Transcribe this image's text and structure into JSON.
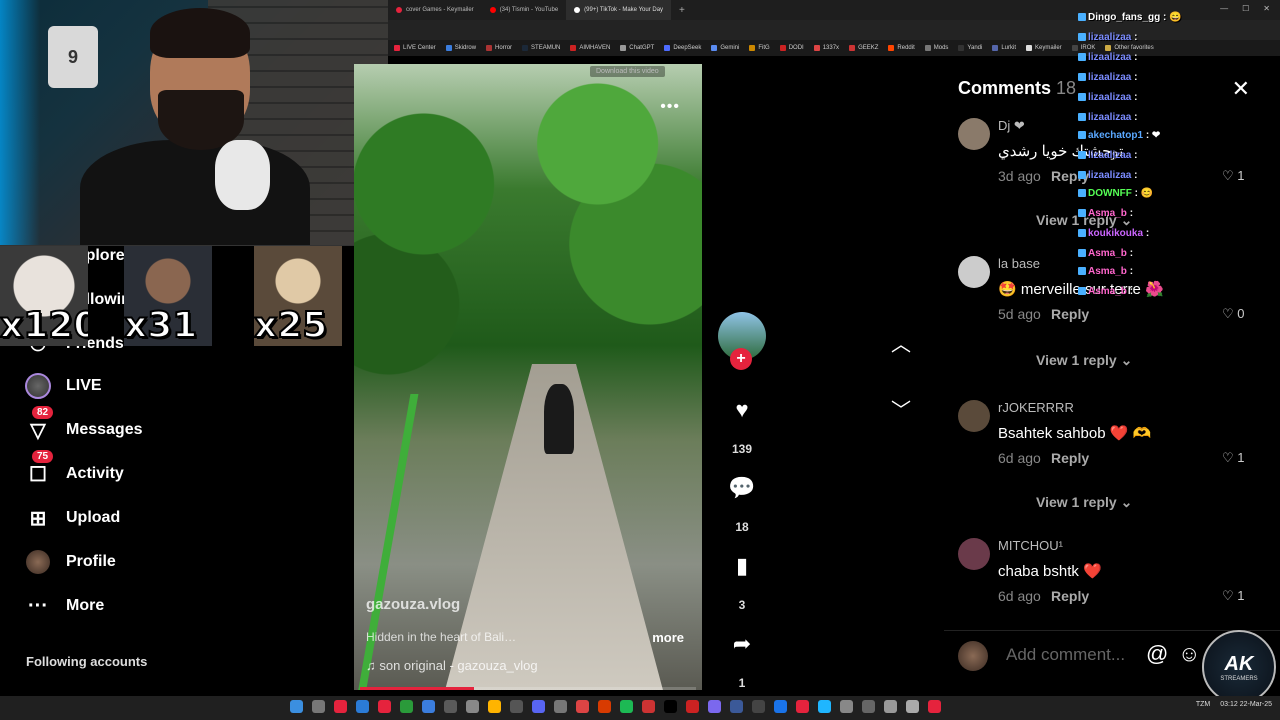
{
  "browser": {
    "tabs": [
      {
        "label": "cover Games - Keymailer",
        "color": "#e5233d"
      },
      {
        "label": "(34) Tismin - YouTube",
        "color": "#ff0000"
      },
      {
        "label": "(99+) TikTok - Make Your Day",
        "color": "#ffffff"
      }
    ],
    "new_tab": "+",
    "bookmarks": [
      {
        "label": "LIVE Center",
        "color": "#e5233d"
      },
      {
        "label": "Skidrow",
        "color": "#3b7ddd"
      },
      {
        "label": "Horror",
        "color": "#aa3333"
      },
      {
        "label": "STEAMUN",
        "color": "#1b2838"
      },
      {
        "label": "AIMHAVEN",
        "color": "#cc2222"
      },
      {
        "label": "ChatGPT",
        "color": "#999999"
      },
      {
        "label": "DeepSeek",
        "color": "#4d6bfe"
      },
      {
        "label": "Gemini",
        "color": "#5a8bf0"
      },
      {
        "label": "FitG",
        "color": "#cc8800"
      },
      {
        "label": "DODI",
        "color": "#cc2222"
      },
      {
        "label": "1337x",
        "color": "#dd4444"
      },
      {
        "label": "GEEKZ",
        "color": "#cc3333"
      },
      {
        "label": "Reddit",
        "color": "#ff4500"
      },
      {
        "label": "Mods",
        "color": "#777777"
      },
      {
        "label": "Yandi",
        "color": "#333333"
      },
      {
        "label": "Lurkit",
        "color": "#5566aa"
      },
      {
        "label": "Keymailer",
        "color": "#dddddd"
      },
      {
        "label": "IROK",
        "color": "#444444"
      },
      {
        "label": "Other favorites",
        "color": "#ccaa44"
      }
    ],
    "download_badge": "Download this video"
  },
  "nav": {
    "items": [
      {
        "label": "Explore",
        "icon": "compass-icon",
        "glyph": "⊘"
      },
      {
        "label": "Following",
        "icon": "following-icon",
        "glyph": "⚇"
      },
      {
        "label": "Friends",
        "icon": "friends-icon",
        "glyph": "⚇"
      },
      {
        "label": "LIVE",
        "icon": "live-icon",
        "glyph": ""
      },
      {
        "label": "Messages",
        "icon": "send-icon",
        "glyph": "▽",
        "badge": "82"
      },
      {
        "label": "Activity",
        "icon": "chat-bubble-icon",
        "glyph": "☐",
        "badge": "75"
      },
      {
        "label": "Upload",
        "icon": "plus-square-icon",
        "glyph": "⊞"
      },
      {
        "label": "Profile",
        "icon": "profile-avatar-icon",
        "glyph": ""
      },
      {
        "label": "More",
        "icon": "more-dots-icon",
        "glyph": "···"
      }
    ],
    "following_title": "Following accounts"
  },
  "alerts": [
    {
      "multiplier": "x120",
      "color": "#d8d2cc"
    },
    {
      "multiplier": "x31",
      "color": "#3a3d44"
    },
    {
      "multiplier": "x25",
      "color": "#c9b7a0"
    }
  ],
  "video": {
    "username": "gazouza.vlog",
    "caption": "Hidden in the heart of Bali…",
    "more_label": "more",
    "sound": "♫  son original - gazouza_vlog",
    "progress": 0.34
  },
  "actions": {
    "likes": "139",
    "comments": "18",
    "saves": "3",
    "shares": "1"
  },
  "comments": {
    "title": "Comments",
    "count": "18",
    "items": [
      {
        "name": "Dj ❤",
        "text": "توحشتك خويا رشدي",
        "date": "3d ago",
        "reply": "Reply",
        "likes": "♡ 1",
        "view_replies": "View 1 reply ⌄",
        "avatar": "#8a7a6a"
      },
      {
        "name": "la base",
        "text": "🤩 merveille sur terre 🌺",
        "date": "5d ago",
        "reply": "Reply",
        "likes": "♡ 0",
        "view_replies": "View 1 reply ⌄",
        "avatar": "#cccccc"
      },
      {
        "name": "rJOKERRRR",
        "text": "Bsahtek sahbob ❤️ 🫶",
        "date": "6d ago",
        "reply": "Reply",
        "likes": "♡ 1",
        "view_replies": "View 1 reply ⌄",
        "avatar": "#5a4a3a"
      },
      {
        "name": "MITCHOU¹",
        "text": "chaba bshtk ❤️",
        "date": "6d ago",
        "reply": "Reply",
        "likes": "♡ 1",
        "view_replies": "",
        "avatar": "#6a3a4a"
      }
    ],
    "add_placeholder": "Add comment...",
    "at_symbol": "@",
    "emoji_symbol": "☺"
  },
  "chat": [
    {
      "user": "Dingo_fans_gg",
      "text": ": 😄",
      "color": "#ffffff"
    },
    {
      "user": "lizaalizaa",
      "text": ":",
      "color": "#7b8cff"
    },
    {
      "user": "lizaalizaa",
      "text": ":",
      "color": "#7b8cff"
    },
    {
      "user": "lizaalizaa",
      "text": ":",
      "color": "#7b8cff"
    },
    {
      "user": "lizaalizaa",
      "text": ":",
      "color": "#7b8cff"
    },
    {
      "user": "lizaalizaa",
      "text": ":",
      "color": "#7b8cff"
    },
    {
      "user": "akechatop1",
      "text": ": ❤",
      "color": "#5aa8ff"
    },
    {
      "user": "lizaalizaa",
      "text": ":",
      "color": "#7b8cff"
    },
    {
      "user": "lizaalizaa",
      "text": ":",
      "color": "#7b8cff"
    },
    {
      "user": "DOWNFF",
      "text": ": 😊",
      "color": "#55ff55"
    },
    {
      "user": "Asma_b",
      "text": ":",
      "color": "#ff66cc"
    },
    {
      "user": "koukikouka",
      "text": ":",
      "color": "#cc66ff"
    },
    {
      "user": "Asma_b",
      "text": ":",
      "color": "#ff66cc"
    },
    {
      "user": "Asma_b",
      "text": ":",
      "color": "#ff66cc"
    },
    {
      "user": "Asma_b",
      "text": ":",
      "color": "#ff66cc"
    }
  ],
  "logo": {
    "title": "AK",
    "subtitle": "STREAMERS"
  },
  "taskbar": {
    "tray_lang": "TZM",
    "time": "03:12",
    "date": "22-Mar-25"
  }
}
